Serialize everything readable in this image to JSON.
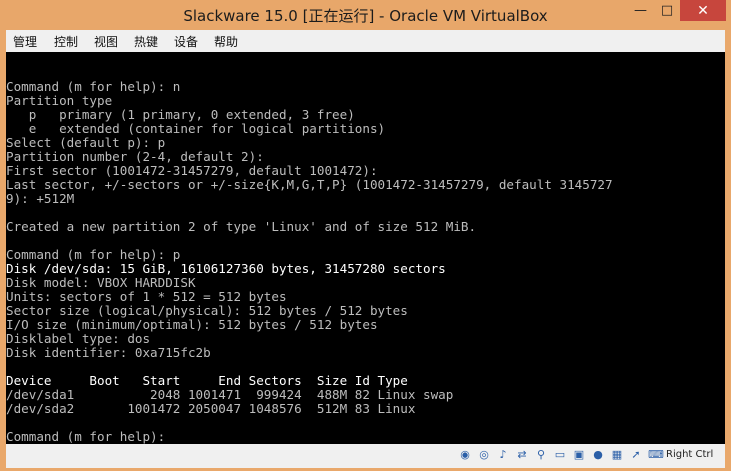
{
  "window": {
    "title": "Slackware 15.0 [正在运行] - Oracle VM VirtualBox",
    "controls": {
      "minimize": "—",
      "maximize": "□",
      "close": "✕"
    }
  },
  "menubar": [
    "管理",
    "控制",
    "视图",
    "热键",
    "设备",
    "帮助"
  ],
  "terminal": {
    "lines": [
      {
        "text": "Command (m for help): n",
        "bright": false
      },
      {
        "text": "Partition type",
        "bright": false
      },
      {
        "text": "   p   primary (1 primary, 0 extended, 3 free)",
        "bright": false
      },
      {
        "text": "   e   extended (container for logical partitions)",
        "bright": false
      },
      {
        "text": "Select (default p): p",
        "bright": false
      },
      {
        "text": "Partition number (2-4, default 2):",
        "bright": false
      },
      {
        "text": "First sector (1001472-31457279, default 1001472):",
        "bright": false
      },
      {
        "text": "Last sector, +/-sectors or +/-size{K,M,G,T,P} (1001472-31457279, default 3145727",
        "bright": false
      },
      {
        "text": "9): +512M",
        "bright": false
      },
      {
        "text": "",
        "bright": false
      },
      {
        "text": "Created a new partition 2 of type 'Linux' and of size 512 MiB.",
        "bright": false
      },
      {
        "text": "",
        "bright": false
      },
      {
        "text": "Command (m for help): p",
        "bright": false
      },
      {
        "text": "Disk /dev/sda: 15 GiB, 16106127360 bytes, 31457280 sectors",
        "bright": true
      },
      {
        "text": "Disk model: VBOX HARDDISK",
        "bright": false
      },
      {
        "text": "Units: sectors of 1 * 512 = 512 bytes",
        "bright": false
      },
      {
        "text": "Sector size (logical/physical): 512 bytes / 512 bytes",
        "bright": false
      },
      {
        "text": "I/O size (minimum/optimal): 512 bytes / 512 bytes",
        "bright": false
      },
      {
        "text": "Disklabel type: dos",
        "bright": false
      },
      {
        "text": "Disk identifier: 0xa715fc2b",
        "bright": false
      },
      {
        "text": "",
        "bright": false
      },
      {
        "text": "Device     Boot   Start     End Sectors  Size Id Type",
        "bright": true
      },
      {
        "text": "/dev/sda1          2048 1001471  999424  488M 82 Linux swap",
        "bright": false
      },
      {
        "text": "/dev/sda2       1001472 2050047 1048576  512M 83 Linux",
        "bright": false
      },
      {
        "text": "",
        "bright": false
      },
      {
        "text": "Command (m for help):",
        "bright": false
      }
    ]
  },
  "statusbar": {
    "icons": [
      "hard-disk-icon",
      "optical-drive-icon",
      "audio-icon",
      "network-icon",
      "usb-icon",
      "shared-folder-icon",
      "display-icon",
      "video-capture-icon",
      "cpu-icon",
      "mouse-integration-icon",
      "keyboard-icon"
    ],
    "host_key": "Right Ctrl"
  }
}
